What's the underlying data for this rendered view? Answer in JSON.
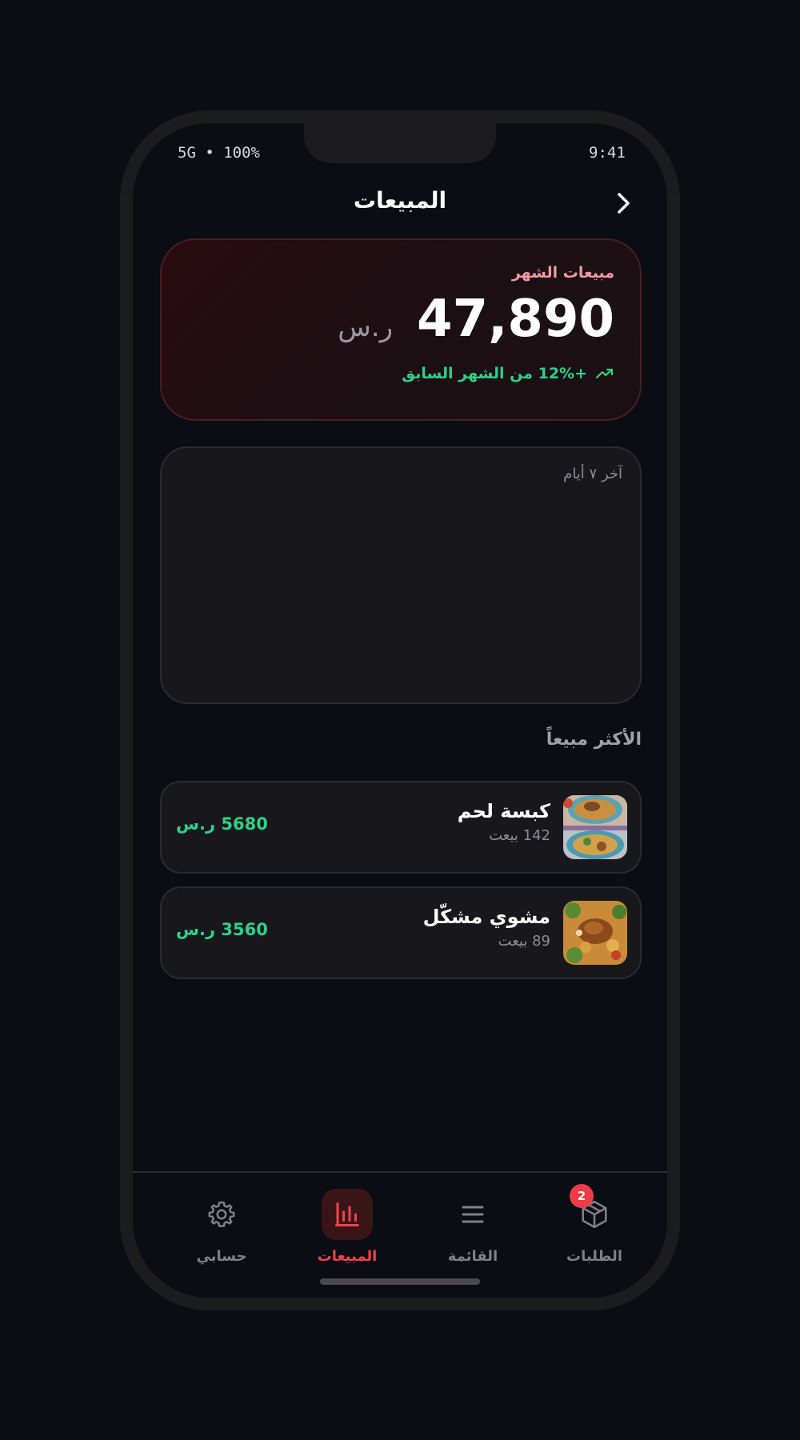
{
  "status_bar": {
    "time": "9:41",
    "signal": "5G • 100%"
  },
  "header": {
    "title": "المبيعات"
  },
  "summary": {
    "label": "مبيعات الشهر",
    "amount": "47,890",
    "currency": "ر.س",
    "trend": "+12% من الشهر السابق",
    "trend_color": "#2fd089"
  },
  "chart_card": {
    "label": "آخر ٧ أيام"
  },
  "best_sellers": {
    "title": "الأكثر مبيعاً",
    "items": [
      {
        "name": "كبسة لحم",
        "sold": "142 بيعت",
        "revenue": "5680 ر.س",
        "thumb_icon": "kabsa-photo"
      },
      {
        "name": "مشوي مشكّل",
        "sold": "89 بيعت",
        "revenue": "3560 ر.س",
        "thumb_icon": "grill-photo"
      }
    ]
  },
  "nav": {
    "items": [
      {
        "label": "الطلبات",
        "icon": "box-icon",
        "badge": "2"
      },
      {
        "label": "القائمة",
        "icon": "menu-icon"
      },
      {
        "label": "المبيعات",
        "icon": "bar-chart-icon",
        "active": true
      },
      {
        "label": "حسابي",
        "icon": "gear-icon"
      }
    ]
  },
  "colors": {
    "accent": "#f0434f",
    "positive": "#2fd089",
    "background": "#0a0d14"
  }
}
